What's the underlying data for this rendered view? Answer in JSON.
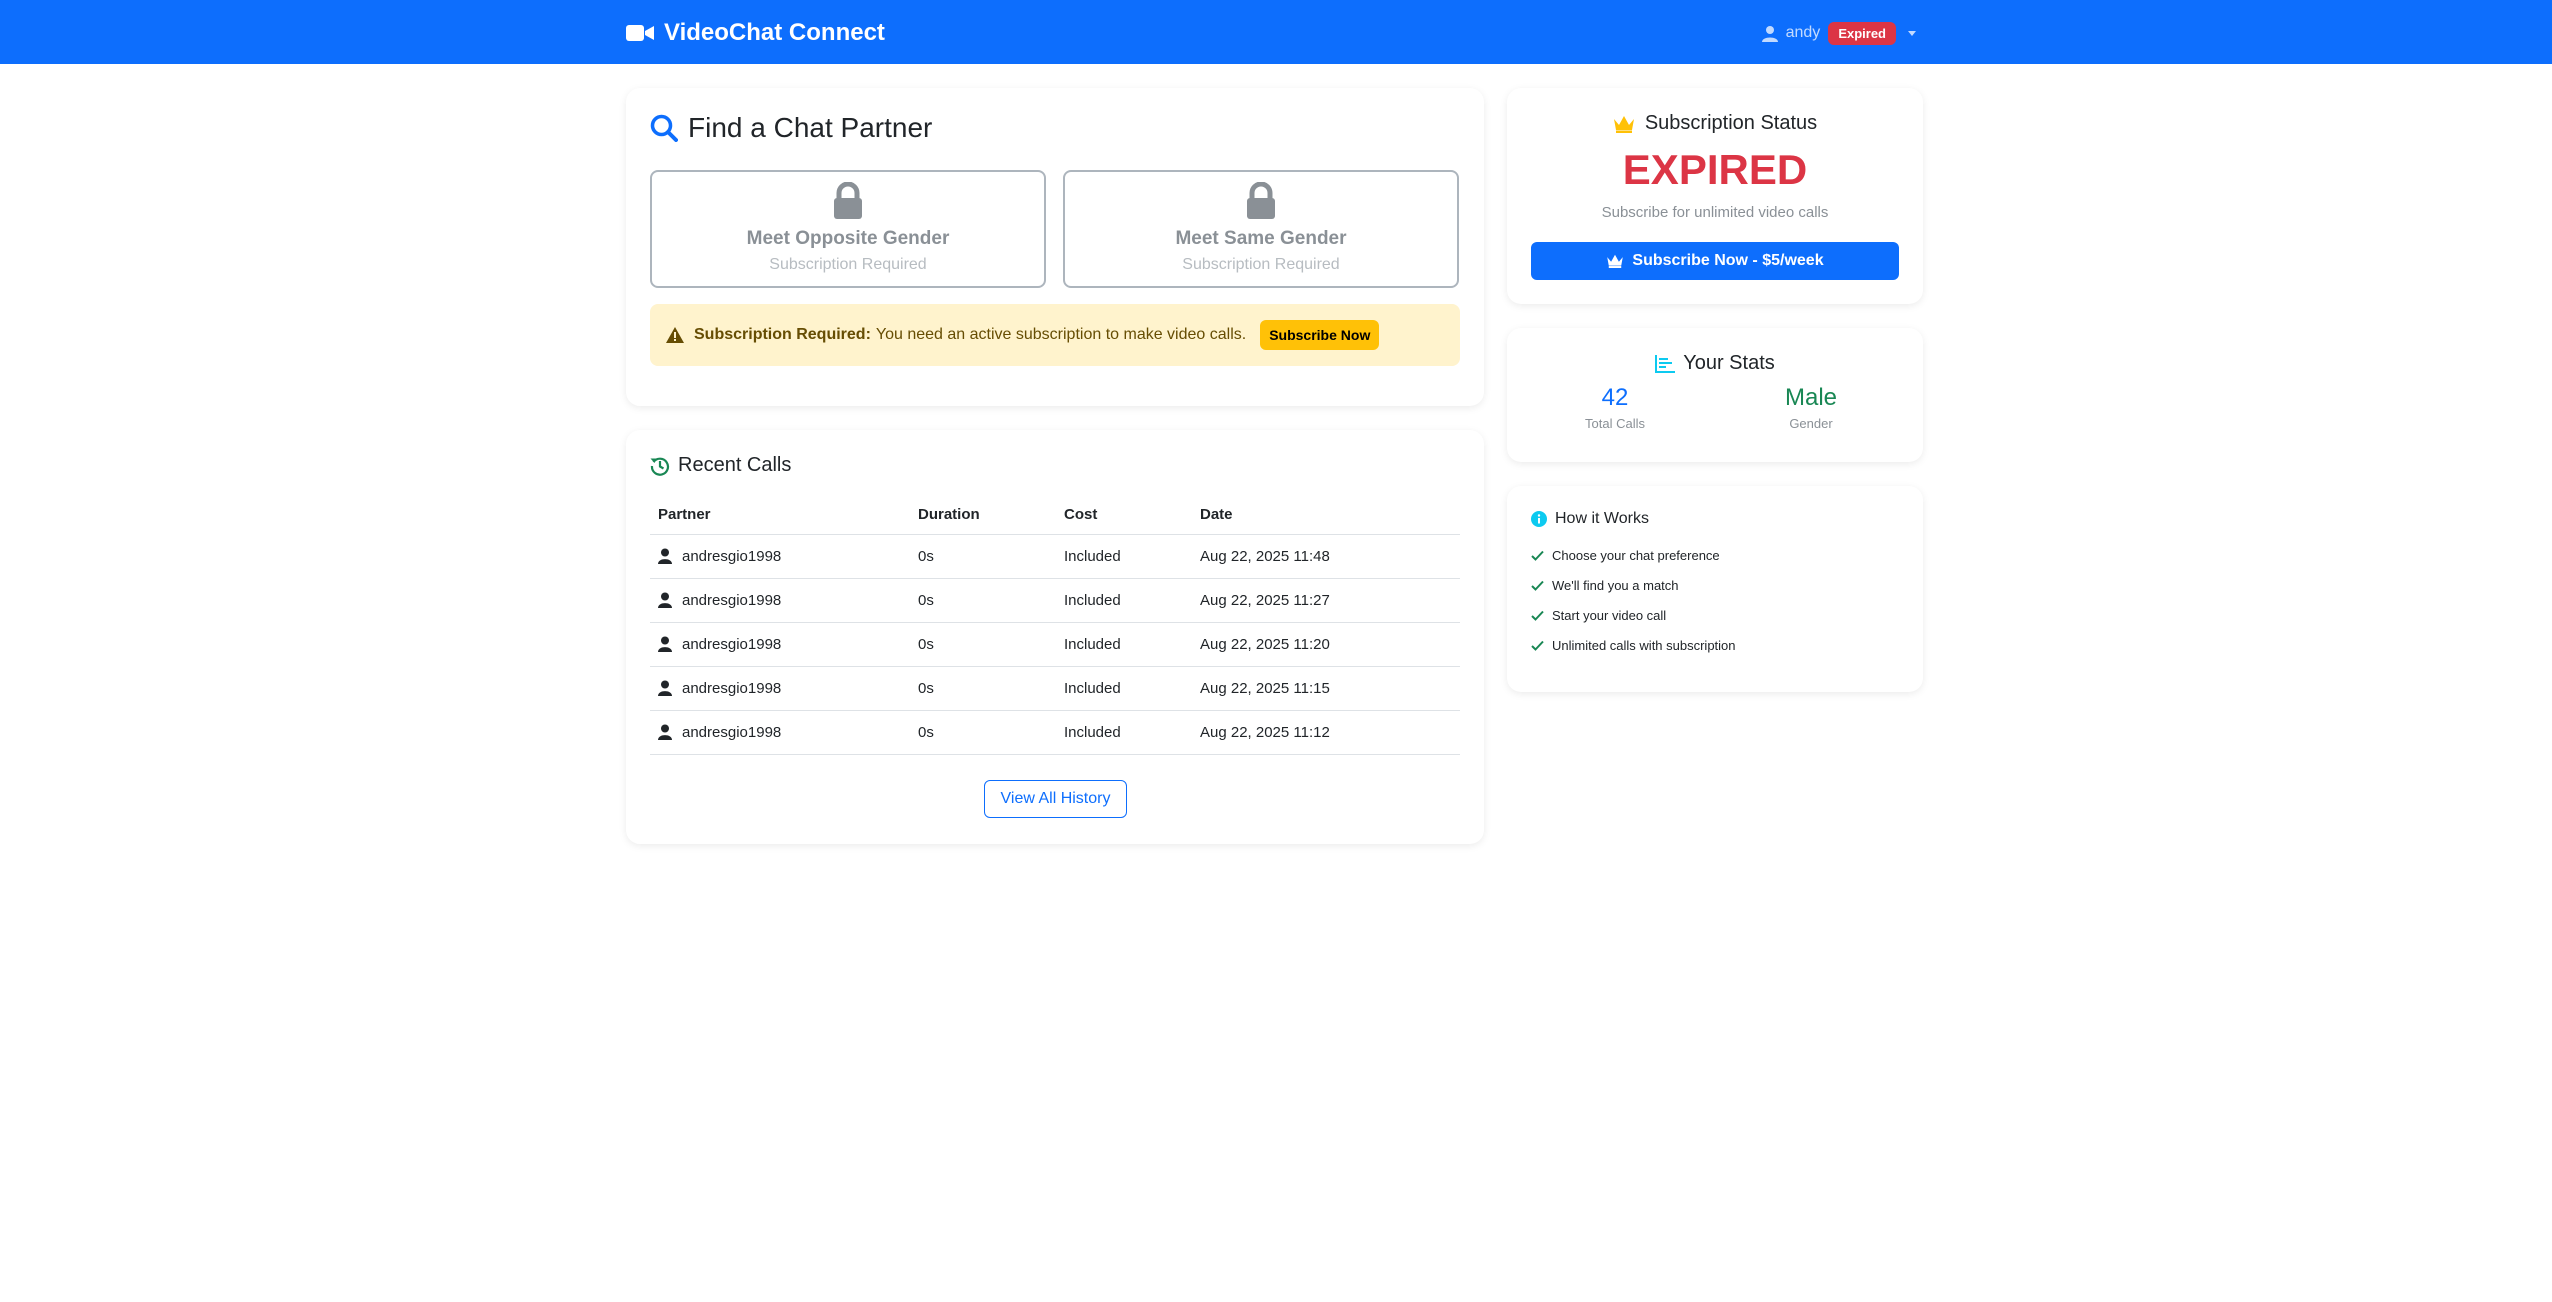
{
  "navbar": {
    "brand": "VideoChat Connect",
    "username": "andy",
    "status_badge": "Expired"
  },
  "find": {
    "title": "Find a Chat Partner",
    "options": [
      {
        "title": "Meet Opposite Gender",
        "subtitle": "Subscription Required"
      },
      {
        "title": "Meet Same Gender",
        "subtitle": "Subscription Required"
      }
    ],
    "alert": {
      "strong": "Subscription Required:",
      "text": "You need an active subscription to make video calls.",
      "button": "Subscribe Now"
    }
  },
  "recent": {
    "title": "Recent Calls",
    "headers": [
      "Partner",
      "Duration",
      "Cost",
      "Date"
    ],
    "rows": [
      {
        "partner": "andresgio1998",
        "duration": "0s",
        "cost": "Included",
        "date": "Aug 22, 2025 11:48"
      },
      {
        "partner": "andresgio1998",
        "duration": "0s",
        "cost": "Included",
        "date": "Aug 22, 2025 11:27"
      },
      {
        "partner": "andresgio1998",
        "duration": "0s",
        "cost": "Included",
        "date": "Aug 22, 2025 11:20"
      },
      {
        "partner": "andresgio1998",
        "duration": "0s",
        "cost": "Included",
        "date": "Aug 22, 2025 11:15"
      },
      {
        "partner": "andresgio1998",
        "duration": "0s",
        "cost": "Included",
        "date": "Aug 22, 2025 11:12"
      }
    ],
    "view_all": "View All History"
  },
  "subscription": {
    "title": "Subscription Status",
    "status": "EXPIRED",
    "text": "Subscribe for unlimited video calls",
    "button": "Subscribe Now - $5/week"
  },
  "stats": {
    "title": "Your Stats",
    "total_calls": "42",
    "total_calls_label": "Total Calls",
    "gender": "Male",
    "gender_label": "Gender"
  },
  "how": {
    "title": "How it Works",
    "steps": [
      "Choose your chat preference",
      "We'll find you a match",
      "Start your video call",
      "Unlimited calls with subscription"
    ]
  },
  "colors": {
    "primary": "#0d6efd",
    "danger": "#dc3545",
    "warning": "#ffc107",
    "success": "#198754",
    "info": "#0dcaf0"
  }
}
